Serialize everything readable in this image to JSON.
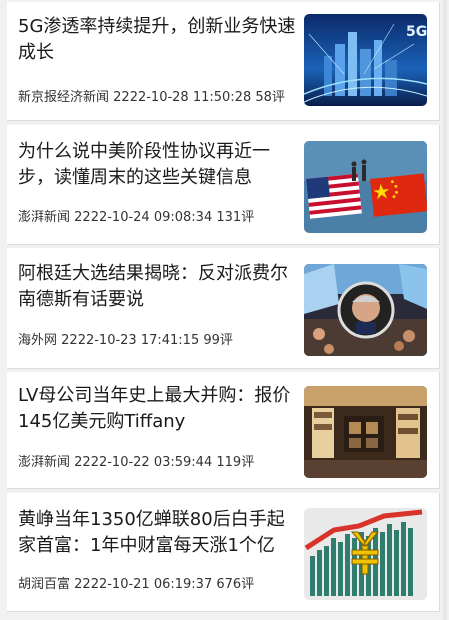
{
  "articles": [
    {
      "title": "5G渗透率持续提升，创新业务快速成长",
      "source": "新京报经济新闻",
      "time": "2222-10-28 11:50:28",
      "comments": "58评",
      "thumbnail": "5g-city-image"
    },
    {
      "title": "为什么说中美阶段性协议再近一步，读懂周末的这些关键信息",
      "source": "澎湃新闻",
      "time": "2222-10-24 09:08:34",
      "comments": "131评",
      "thumbnail": "us-china-flags-image"
    },
    {
      "title": "阿根廷大选结果揭晓：反对派费尔南德斯有话要说",
      "source": "海外网",
      "time": "2222-10-23 17:41:15",
      "comments": "99评",
      "thumbnail": "argentina-rally-image"
    },
    {
      "title": "LV母公司当年史上最大并购：报价145亿美元购Tiffany",
      "source": "澎湃新闻",
      "time": "2222-10-22 03:59:44",
      "comments": "119评",
      "thumbnail": "lv-store-image"
    },
    {
      "title": "黄峥当年1350亿蝉联80后白手起家首富：1年中财富每天涨1个亿",
      "source": "胡润百富",
      "time": "2222-10-21 06:19:37",
      "comments": "676评",
      "thumbnail": "yuan-chart-image"
    }
  ],
  "thumb_text": {
    "five_g": "5G"
  }
}
